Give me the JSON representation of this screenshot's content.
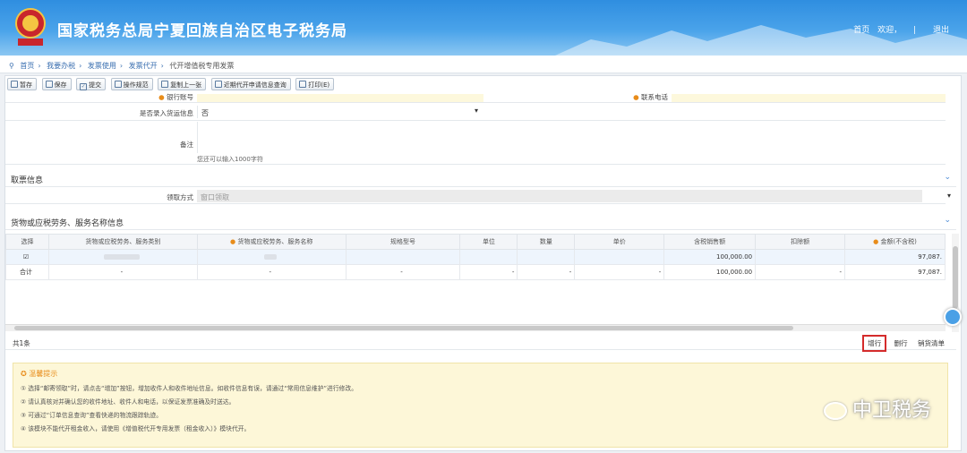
{
  "header": {
    "site_title": "国家税务总局宁夏回族自治区电子税务局",
    "links": {
      "home": "首页",
      "welcome": "欢迎，",
      "logout": "退出"
    },
    "emblem_text": "中国税务"
  },
  "breadcrumb": [
    "首页",
    "我要办税",
    "发票使用",
    "发票代开",
    "代开增值税专用发票"
  ],
  "toolbar": [
    {
      "label": "暂存",
      "icon": "save-draft-icon"
    },
    {
      "label": "保存",
      "icon": "save-icon"
    },
    {
      "label": "提交",
      "icon": "submit-icon"
    },
    {
      "label": "操作规范",
      "icon": "guide-icon"
    },
    {
      "label": "复制上一张",
      "icon": "copy-icon"
    },
    {
      "label": "近期代开申请信息查询",
      "icon": "query-icon"
    },
    {
      "label": "打印(E)",
      "icon": "print-icon"
    }
  ],
  "form": {
    "bank_account_label": "银行账号",
    "contact_phone_label": "联系电话",
    "logistics_label": "是否录入货运信息",
    "logistics_value": "否",
    "remark_label": "备注",
    "remark_hint": "您还可以输入1000字符"
  },
  "pickup": {
    "section_title": "取票信息",
    "method_label": "领取方式",
    "method_value": "窗口领取"
  },
  "goods": {
    "section_title": "货物或应税劳务、服务名称信息",
    "columns": [
      "选择",
      "货物或应税劳务、服务类别",
      "货物或应税劳务、服务名称",
      "规格型号",
      "单位",
      "数量",
      "单价",
      "含税销售额",
      "扣除额",
      "金额(不含税)"
    ],
    "row": {
      "checked": "☑",
      "sales": "100,000.00",
      "amount": "97,087."
    },
    "total_row": {
      "label": "合计",
      "dash": "-",
      "sales": "100,000.00",
      "amount": "97,087."
    }
  },
  "pager": {
    "total": "共1条",
    "buttons": [
      "增行",
      "删行",
      "销货清单"
    ]
  },
  "tips": {
    "title": "温馨提示",
    "items": [
      "① 选择“邮寄领取”时，请点击“增加”按钮，增加收件人和收件地址信息。如收件信息有误，请通过“常用信息维护”进行修改。",
      "② 请认真核对并确认您的收件地址、收件人和电话，以保证发票准确及时送达。",
      "③ 可通过“订单信息查询”查看快递的物流跟踪轨迹。",
      "④ 该模块不能代开租金收入，请使用《增值税代开专用发票（租金收入）》模块代开。"
    ]
  },
  "watermark": "中卫税务"
}
